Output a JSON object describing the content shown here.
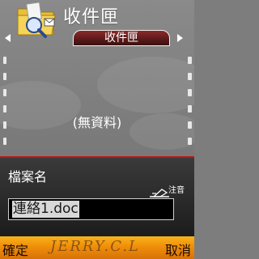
{
  "header": {
    "title": "收件匣",
    "app_icon": "inbox-folder-icon"
  },
  "tabs": {
    "active_label": "收件匣"
  },
  "main": {
    "empty_message": "(無資料)"
  },
  "dialog": {
    "title": "檔案名",
    "input_mode_label": "注音",
    "filename_value": "連絡1.doc"
  },
  "softkeys": {
    "left": "確定",
    "right": "取消",
    "watermark": "JERRY.C.L"
  },
  "colors": {
    "accent_red": "#b81a1a",
    "softkey_orange": "#f08e0a",
    "background_gray": "#7d7d7d"
  }
}
